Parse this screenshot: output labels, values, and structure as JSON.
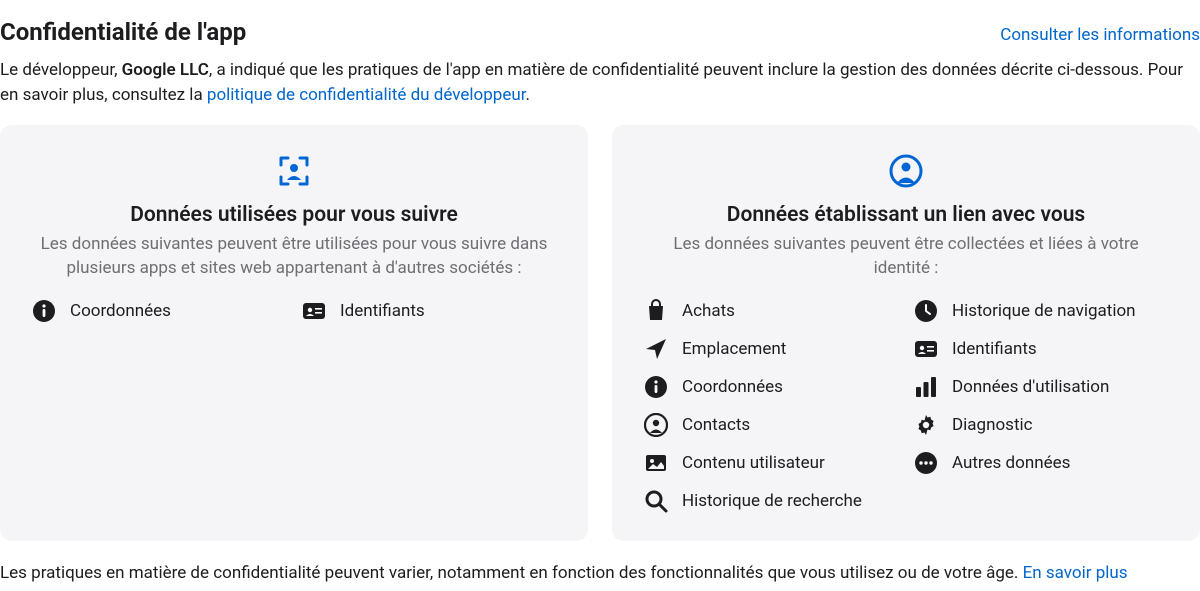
{
  "header": {
    "title": "Confidentialité de l'app",
    "details_link": "Consulter les informations"
  },
  "intro": {
    "prefix": "Le développeur, ",
    "developer": "Google LLC",
    "middle": ", a indiqué que les pratiques de l'app en matière de confidentialité peuvent inclure la gestion des données décrite ci-dessous. Pour en savoir plus, consultez la ",
    "policy_link": "politique de confidentialité du développeur",
    "suffix": "."
  },
  "cards": [
    {
      "icon": "tracking",
      "title": "Données utilisées pour vous suivre",
      "desc": "Les données suivantes peuvent être utilisées pour vous suivre dans plusieurs apps et sites web appartenant à d'autres sociétés :",
      "items": [
        {
          "icon": "info",
          "label": "Coordonnées"
        },
        {
          "icon": "id-card",
          "label": "Identifiants"
        }
      ]
    },
    {
      "icon": "linked",
      "title": "Données établissant un lien avec vous",
      "desc": "Les données suivantes peuvent être collectées et liées à votre identité :",
      "items": [
        {
          "icon": "bag",
          "label": "Achats"
        },
        {
          "icon": "clock",
          "label": "Historique de navigation"
        },
        {
          "icon": "location",
          "label": "Emplacement"
        },
        {
          "icon": "id-card",
          "label": "Identifiants"
        },
        {
          "icon": "info",
          "label": "Coordonnées"
        },
        {
          "icon": "bars",
          "label": "Données d'utilisation"
        },
        {
          "icon": "contacts",
          "label": "Contacts"
        },
        {
          "icon": "gear",
          "label": "Diagnostic"
        },
        {
          "icon": "image",
          "label": "Contenu utilisateur"
        },
        {
          "icon": "ellipsis",
          "label": "Autres données"
        },
        {
          "icon": "search",
          "label": "Historique de recherche"
        }
      ]
    }
  ],
  "footer": {
    "text": "Les pratiques en matière de confidentialité peuvent varier, notamment en fonction des fonctionnalités que vous utilisez ou de votre âge. ",
    "link": "En savoir plus"
  }
}
